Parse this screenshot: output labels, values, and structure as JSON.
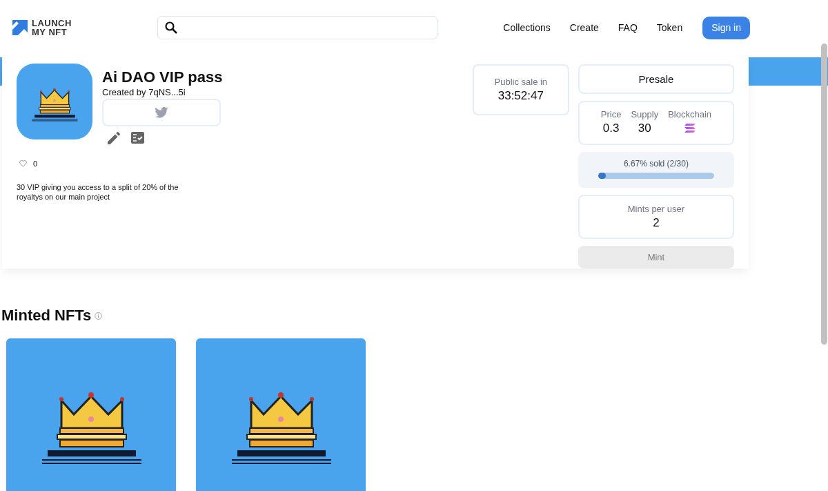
{
  "header": {
    "logo": [
      "LAUNCH",
      "MY NFT"
    ],
    "nav": [
      "Collections",
      "Create",
      "FAQ",
      "Token"
    ],
    "sign_in": "Sign in"
  },
  "collection": {
    "title": "Ai DAO VIP pass",
    "creator": "Created by 7qNS...5i",
    "likes": "0",
    "description": "30 VIP giving you access to a split of 20% of the royaltys on our main project"
  },
  "countdown": {
    "label": "Public sale in",
    "value": "33:52:47"
  },
  "sale": {
    "phase": "Presale",
    "stats": [
      {
        "label": "Price",
        "value": "0.3",
        "kind": "text"
      },
      {
        "label": "Supply",
        "value": "30",
        "kind": "text"
      },
      {
        "label": "Blockchain",
        "kind": "chain-icon"
      }
    ],
    "progress": {
      "text": "6.67% sold (2/30)",
      "level": 0.0667
    },
    "mints": {
      "label": "Mints per user",
      "value": "2"
    },
    "mint_button": {
      "label": "Mint",
      "disabled": true
    }
  },
  "minted": {
    "title": "Minted NFTs"
  }
}
